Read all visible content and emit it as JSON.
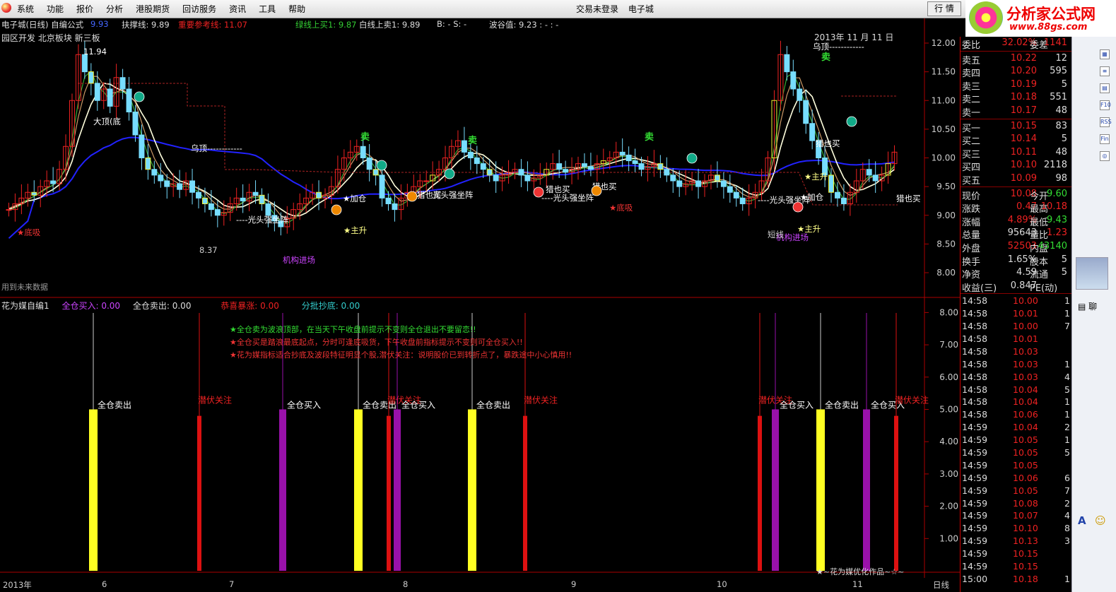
{
  "menubar": {
    "items": [
      "系统",
      "功能",
      "报价",
      "分析",
      "港股期货",
      "回访服务",
      "资讯",
      "工具",
      "帮助"
    ],
    "center_status": "交易未登录",
    "center_app": "电子城",
    "window_button": "行 情"
  },
  "brand": {
    "name": "分析家公式网",
    "url": "www.88gs.com"
  },
  "main_chart": {
    "title": "电子城(日线) 自编公式",
    "price": "9.93",
    "support": "扶撑线: 9.89",
    "ref": "重要参考线: 11.07",
    "green_buy": "绿线上买1: 9.87",
    "white_sell": "白线上卖1: 9.89",
    "bs": "B: -   S: -",
    "wave": "波谷值: 9.23 : -       : -",
    "sector": "园区开发 北京板块 新三板",
    "future_note": "用到未来数据",
    "date_label": "2013年 11 月 11 日",
    "y_ticks": [
      "12.00",
      "11.50",
      "11.00",
      "10.50",
      "10.00",
      "9.50",
      "9.00",
      "8.50",
      "8.00"
    ],
    "annotations": [
      "11.94",
      "大顶(底",
      "乌顶------------",
      "乌顶------------",
      "★底吸",
      "★底吸",
      "★主升",
      "★主升",
      "★主升",
      "★加仓",
      "★加仓",
      "机构进场",
      "机构进场",
      "8.37",
      "----光头强坐阵",
      "----光头强坐阵",
      "----光头强坐阵",
      "光头强坐阵",
      "猎也买",
      "猎也买",
      "猎也买",
      "猎也买",
      "猎也买",
      "短线",
      "加仓"
    ]
  },
  "sub_chart": {
    "name": "花为媒自编1",
    "buy_all": "全仓买入: 0.00",
    "sell_all": "全仓卖出: 0.00",
    "surge": "恭喜暴涨: 0.00",
    "batch": "分批抄底: 0.00",
    "notes": [
      "★全仓卖为波浪顶部，在当天下午收盘前提示不变则全仓退出不要留恋!!",
      "★全仓买是踏浪最底起点，分时可逢底吸货，下午收盘前指标提示不变则可全仓买入!!",
      "★花为媒指标适合抄底及波段特征明显个股,潜伏关注：说明股价已到转折点了，暴跌途中小心慎用!!"
    ],
    "y_ticks": [
      "8.00",
      "7.00",
      "6.00",
      "5.00",
      "4.00",
      "3.00",
      "2.00",
      "1.00"
    ],
    "labels": {
      "sell": "全仓卖出",
      "buy": "全仓买入",
      "watch": "潜伏关注"
    },
    "footer": "★~花为媒优化作品~☆~"
  },
  "time_axis": [
    "2013年",
    "6",
    "7",
    "8",
    "9",
    "10",
    "11"
  ],
  "time_axis_right": "日线",
  "quote": {
    "wei": {
      "label": "委比",
      "pct": "32.02%",
      "label2": "委差",
      "diff": "1141"
    },
    "sells": [
      {
        "l": "卖五",
        "p": "10.22",
        "v": "12"
      },
      {
        "l": "卖四",
        "p": "10.20",
        "v": "595"
      },
      {
        "l": "卖三",
        "p": "10.19",
        "v": "5"
      },
      {
        "l": "卖二",
        "p": "10.18",
        "v": "551"
      },
      {
        "l": "卖一",
        "p": "10.17",
        "v": "48"
      }
    ],
    "buys": [
      {
        "l": "买一",
        "p": "10.15",
        "v": "83"
      },
      {
        "l": "买二",
        "p": "10.14",
        "v": "5"
      },
      {
        "l": "买三",
        "p": "10.11",
        "v": "48"
      },
      {
        "l": "买四",
        "p": "10.10",
        "v": "2118"
      },
      {
        "l": "买五",
        "p": "10.09",
        "v": "98"
      }
    ],
    "stats": [
      {
        "l": "现价",
        "v": "10.08",
        "l2": "今开",
        "v2": "9.60",
        "c": "#e22",
        "c2": "#3d3"
      },
      {
        "l": "涨跌",
        "v": "0.47",
        "l2": "最高",
        "v2": "10.18",
        "c": "#e22",
        "c2": "#e22"
      },
      {
        "l": "涨幅",
        "v": "4.89%",
        "l2": "最低",
        "v2": "9.43",
        "c": "#e22",
        "c2": "#3d3"
      },
      {
        "l": "总量",
        "v": "95643",
        "l2": "量比",
        "v2": "1.23",
        "c": "#ddd",
        "c2": "#e22"
      },
      {
        "l": "外盘",
        "v": "52503",
        "l2": "内盘",
        "v2": "43140",
        "c": "#e22",
        "c2": "#3d3"
      },
      {
        "l": "换手",
        "v": "1.65%",
        "l2": "股本",
        "v2": "5",
        "c": "#ddd",
        "c2": "#ddd"
      },
      {
        "l": "净资",
        "v": "4.59",
        "l2": "流通",
        "v2": "5",
        "c": "#ddd",
        "c2": "#ddd"
      },
      {
        "l": "收益(三)",
        "v": "0.847",
        "l2": "PE(动)",
        "v2": "",
        "c": "#ddd",
        "c2": "#ddd"
      }
    ],
    "ticks": [
      {
        "t": "14:58",
        "p": "10.00",
        "v": "1",
        "pc": "#e22"
      },
      {
        "t": "14:58",
        "p": "10.01",
        "v": "1",
        "pc": "#e22"
      },
      {
        "t": "14:58",
        "p": "10.00",
        "v": "7",
        "pc": "#e22"
      },
      {
        "t": "14:58",
        "p": "10.01",
        "v": "",
        "pc": "#e22"
      },
      {
        "t": "14:58",
        "p": "10.03",
        "v": "",
        "pc": "#e22"
      },
      {
        "t": "14:58",
        "p": "10.03",
        "v": "1",
        "pc": "#e22"
      },
      {
        "t": "14:58",
        "p": "10.03",
        "v": "4",
        "pc": "#e22"
      },
      {
        "t": "14:58",
        "p": "10.04",
        "v": "5",
        "pc": "#e22"
      },
      {
        "t": "14:58",
        "p": "10.04",
        "v": "1",
        "pc": "#e22"
      },
      {
        "t": "14:58",
        "p": "10.06",
        "v": "1",
        "pc": "#e22"
      },
      {
        "t": "14:59",
        "p": "10.04",
        "v": "2",
        "pc": "#e22"
      },
      {
        "t": "14:59",
        "p": "10.05",
        "v": "1",
        "pc": "#e22"
      },
      {
        "t": "14:59",
        "p": "10.05",
        "v": "5",
        "pc": "#e22"
      },
      {
        "t": "14:59",
        "p": "10.05",
        "v": "",
        "pc": "#e22"
      },
      {
        "t": "14:59",
        "p": "10.06",
        "v": "6",
        "pc": "#e22"
      },
      {
        "t": "14:59",
        "p": "10.05",
        "v": "7",
        "pc": "#e22"
      },
      {
        "t": "14:59",
        "p": "10.08",
        "v": "2",
        "pc": "#e22"
      },
      {
        "t": "14:59",
        "p": "10.07",
        "v": "4",
        "pc": "#e22"
      },
      {
        "t": "14:59",
        "p": "10.10",
        "v": "8",
        "pc": "#e22"
      },
      {
        "t": "14:59",
        "p": "10.13",
        "v": "3",
        "pc": "#e22"
      },
      {
        "t": "14:59",
        "p": "10.15",
        "v": "",
        "pc": "#e22"
      },
      {
        "t": "14:59",
        "p": "10.15",
        "v": "",
        "pc": "#e22"
      },
      {
        "t": "15:00",
        "p": "10.18",
        "v": "1",
        "pc": "#e22"
      }
    ]
  },
  "side_icons": [
    "chart-icon",
    "list-icon",
    "table-icon",
    "f10-icon",
    "rss-icon",
    "fin-icon",
    "news-icon"
  ],
  "chat": "聊"
}
